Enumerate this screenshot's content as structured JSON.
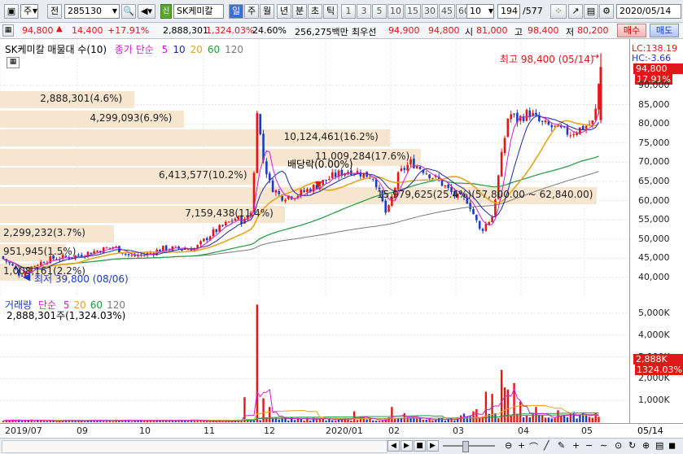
{
  "toolbar": {
    "type_select": "주",
    "all_label": "전",
    "code": "285130",
    "badge": "신",
    "name": "SK케미칼",
    "periods": [
      "일",
      "주",
      "월",
      "년",
      "분",
      "초",
      "틱"
    ],
    "active_period": "일",
    "intervals": [
      "1",
      "3",
      "5",
      "10",
      "15",
      "30",
      "45",
      "60"
    ],
    "interval_value": "10",
    "count": "194",
    "total": "/577",
    "date": "2020/05/14"
  },
  "quote": {
    "price": "94,800",
    "change": "14,400",
    "rate": "+17.91%",
    "volume": "2,888,301",
    "vol_rate": "1,324.03%",
    "turnover": "24.60%",
    "amount": "256,275백만",
    "pref_label": "최우선",
    "ask": "94,900",
    "bid": "94,800",
    "open_label": "시",
    "open": "81,000",
    "high_label": "고",
    "high": "98,400",
    "low_label": "저",
    "low": "80,200",
    "buy_button": "매수",
    "sell_button": "매도"
  },
  "price_chart": {
    "legend_main": "SK케미칼 매물대 수(10)",
    "legend_ma_label": "종가 단순",
    "ma_periods": [
      "5",
      "10",
      "20",
      "60",
      "120"
    ],
    "ma_colors": [
      "#d11fd1",
      "#1a2aa8",
      "#e8a41e",
      "#1f9b3a",
      "#7a7a7a"
    ],
    "high_marker": "최고 98,400 (05/14)",
    "low_marker": "최저 39,800 (08/06)",
    "dividend": "배당락(0.00%)",
    "volume_profile": [
      {
        "label": "1,008,161(2.2%)",
        "volume": 1008161
      },
      {
        "label": "951,945(1.5%)",
        "volume": 951945
      },
      {
        "label": "2,299,232(3.7%)",
        "volume": 2299232
      },
      {
        "label": "7,159,438(11.4%)",
        "volume": 7159438
      },
      {
        "label": "15,979,625(25.4%)(57,800.00 ~ 62,840.00)",
        "volume": 15979625
      },
      {
        "label": "6,413,577(10.2%)",
        "volume": 6413577
      },
      {
        "label": "11,009,284(17.6%)",
        "volume": 11009284
      },
      {
        "label": "10,124,461(16.2%)",
        "volume": 10124461
      },
      {
        "label": "4,299,093(6.9%)",
        "volume": 4299093
      },
      {
        "label": "2,888,301(4.6%)",
        "volume": 2888301
      }
    ],
    "axis_labels": [
      "90,000",
      "85,000",
      "80,000",
      "75,000",
      "70,000",
      "65,000",
      "60,000",
      "55,000",
      "50,000",
      "45,000",
      "40,000"
    ],
    "lc_label": "LC:138.19",
    "hc_label": "HC:-3.66",
    "price_tag": "94,800",
    "rate_tag": "17.91%"
  },
  "volume_chart": {
    "legend_title": "거래량",
    "legend_ma_label": "단순",
    "ma_periods": [
      "5",
      "20",
      "60",
      "120"
    ],
    "info": "2,888,301주(1,324.03%)",
    "axis_labels": [
      "5,000K",
      "4,000K",
      "3,000K",
      "2,000K",
      "1,000K"
    ],
    "volume_tag": "2,888K",
    "rate_tag": "1324.03%"
  },
  "date_axis": {
    "labels": [
      "2019/07",
      "09",
      "10",
      "11",
      "12",
      "2020/01",
      "02",
      "03",
      "04",
      "05"
    ],
    "right_label": "05/14"
  },
  "chart_data": {
    "type": "candlestick",
    "start_price": 45000,
    "end_price": 94800,
    "high": 98400,
    "low": 39800
  }
}
